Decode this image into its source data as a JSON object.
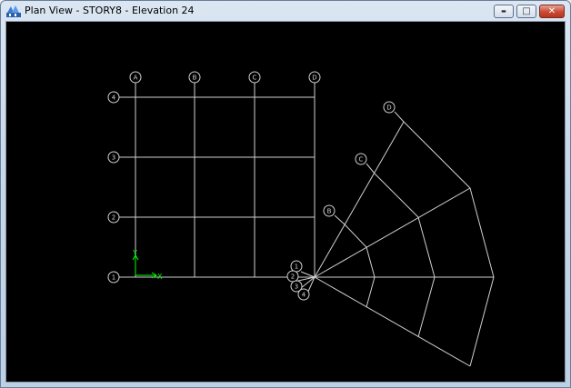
{
  "window": {
    "title": "Plan View - STORY8 - Elevation 24",
    "controls": {
      "minimize": "▬",
      "maximize": "□",
      "close": "✕"
    }
  },
  "colors": {
    "grid_lines": "#cfcfcf",
    "bubble_text": "#cfcfcf",
    "axis": "#00ff00",
    "background": "#000000"
  },
  "rect_grid": {
    "columns": [
      "A",
      "B",
      "C",
      "D"
    ],
    "rows": [
      "1",
      "2",
      "3",
      "4"
    ]
  },
  "radial_grid": {
    "rings": [
      "B",
      "C",
      "D"
    ],
    "spokes": [
      "1",
      "2",
      "3",
      "4"
    ]
  },
  "axes": {
    "x_label": "X",
    "y_label": "Y"
  }
}
